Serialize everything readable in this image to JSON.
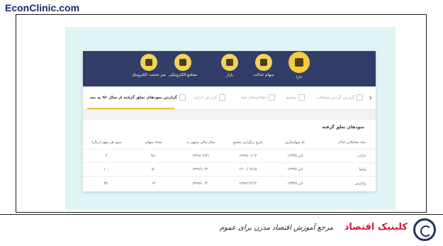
{
  "site": {
    "title": "EconClinic.com"
  },
  "nav": {
    "items": [
      {
        "label": "دارا",
        "icon": "gift-icon",
        "active": true
      },
      {
        "label": "سهام عدالت",
        "icon": "justice-shares-icon"
      },
      {
        "label": "بازار",
        "icon": "market-icon"
      },
      {
        "label": "مجامع الکترونیکی",
        "icon": "meetings-icon"
      },
      {
        "label": "میز خدمت الکترونیک",
        "icon": "service-desk-icon"
      }
    ]
  },
  "tabs": {
    "items": [
      {
        "label": "گزارش گردش معاملات"
      },
      {
        "label": "مجامع"
      },
      {
        "label": "اطلاعیه‌های نماد"
      },
      {
        "label": "گزارش دارایی"
      },
      {
        "label": "گزارش سودهای تعلق گرفته از سال ۹۶ به بعد",
        "active": true
      }
    ]
  },
  "section": {
    "title": "سودهای تعلق گرفته"
  },
  "table": {
    "headers": [
      "نماد معاملاتی کدال",
      "کد سهامداری",
      "تاریخ برگزاری مجمع",
      "سال مالی منتهی به",
      "تعداد سهام",
      "سود هر سهم (ریال)"
    ],
    "rows": [
      [
        "تاراب",
        "آتن ۱۲۳۴۵",
        "۱۳۹۹/۰۱/۰۳",
        "۱۳۹۹/۰۶/۳۱",
        "۹۸۰",
        "۲"
      ],
      [
        "وانوا",
        "آتن ۱۲۳۴۵",
        "۱۴۰۰/۰۲/۱۵",
        "۱۳۹۹/۱۰/۳۰",
        "۵۰",
        "۱۰۰"
      ],
      [
        "واپارس",
        "آتن ۱۲۳۴۵",
        "۱۳۹۹/۱۲/۱۴",
        "۱۳۹۹/۱۰/۳۰",
        "۱۴",
        "۳۵۰"
      ]
    ]
  },
  "footer": {
    "brand": "کلینیک اقتصاد",
    "slogan": "مرجع آموزش اقتصاد مدرن برای عموم",
    "logo_icon": "econclinic-logo-icon"
  },
  "colors": {
    "nav_bg": "#313d66",
    "accent_yellow": "#f3d357",
    "stage_bg": "#dff4f4",
    "brand_red": "#d0183b",
    "brand_navy": "#23305e"
  }
}
